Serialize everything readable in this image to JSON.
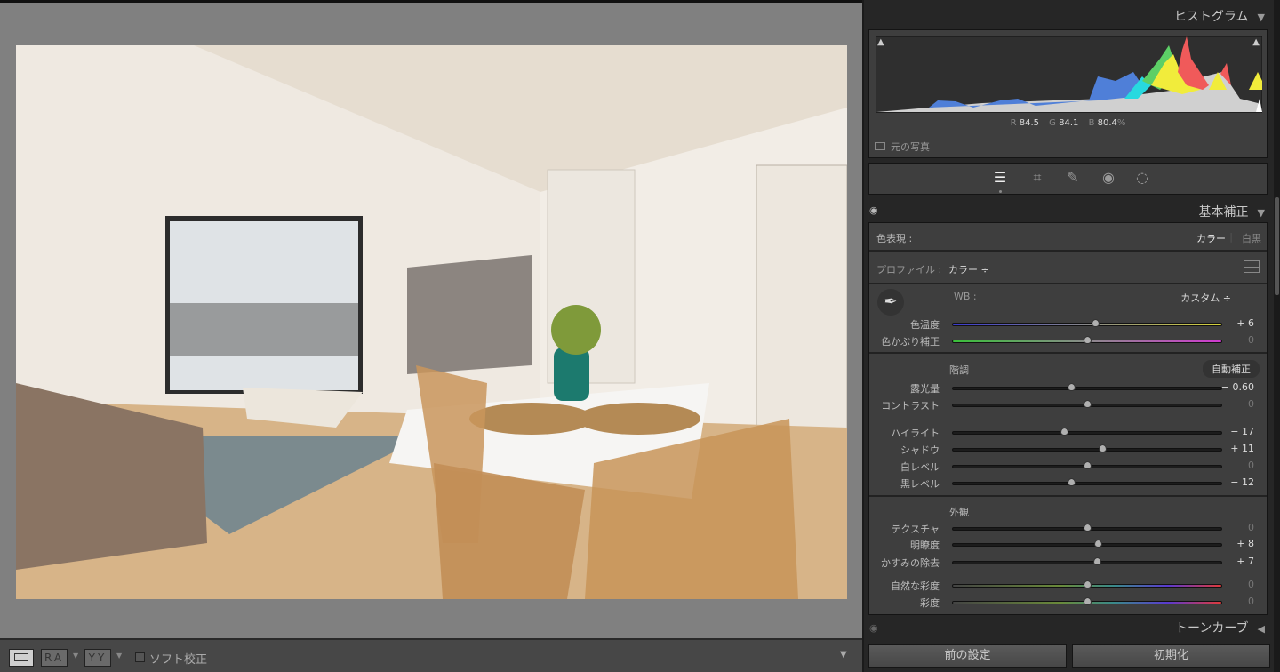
{
  "histogram": {
    "title": "ヒストグラム",
    "r_label": "R",
    "r": "84.5",
    "g_label": "G",
    "g": "84.1",
    "b_label": "B",
    "b": "80.4",
    "pct": "%",
    "original_photo": "元の写真"
  },
  "tools": [
    "edit-sliders",
    "crop",
    "healing",
    "red-eye",
    "masking"
  ],
  "basic": {
    "title": "基本補正",
    "treatment_label": "色表現 :",
    "treatment_color": "カラー",
    "treatment_bw": "白黒",
    "profile_label": "プロファイル :",
    "profile_value": "カラー ÷",
    "wb_label": "WB :",
    "wb_value": "カスタム ÷",
    "tone_label": "階調",
    "auto_label": "自動補正",
    "presence_label": "外観",
    "sliders": [
      {
        "label": "色温度",
        "value": "+ 6",
        "num": 6,
        "min": -100,
        "max": 100,
        "track": "temp"
      },
      {
        "label": "色かぶり補正",
        "value": "0",
        "num": 0,
        "min": -100,
        "max": 100,
        "track": "tint"
      },
      {
        "label": "露光量",
        "value": "− 0.60",
        "num": -0.6,
        "min": -5,
        "max": 5
      },
      {
        "label": "コントラスト",
        "value": "0",
        "num": 0,
        "min": -100,
        "max": 100
      },
      {
        "label": "ハイライト",
        "value": "− 17",
        "num": -17,
        "min": -100,
        "max": 100
      },
      {
        "label": "シャドウ",
        "value": "+ 11",
        "num": 11,
        "min": -100,
        "max": 100
      },
      {
        "label": "白レベル",
        "value": "0",
        "num": 0,
        "min": -100,
        "max": 100
      },
      {
        "label": "黒レベル",
        "value": "− 12",
        "num": -12,
        "min": -100,
        "max": 100
      },
      {
        "label": "テクスチャ",
        "value": "0",
        "num": 0,
        "min": -100,
        "max": 100
      },
      {
        "label": "明瞭度",
        "value": "+ 8",
        "num": 8,
        "min": -100,
        "max": 100
      },
      {
        "label": "かすみの除去",
        "value": "+ 7",
        "num": 7,
        "min": -100,
        "max": 100
      },
      {
        "label": "自然な彩度",
        "value": "0",
        "num": 0,
        "min": -100,
        "max": 100,
        "track": "sat"
      },
      {
        "label": "彩度",
        "value": "0",
        "num": 0,
        "min": -100,
        "max": 100,
        "track": "sat"
      }
    ]
  },
  "tone_curve": {
    "title": "トーンカーブ"
  },
  "buttons": {
    "previous": "前の設定",
    "reset": "初期化"
  },
  "toolbar": {
    "ra": "RA",
    "yy": "YY",
    "soft_proof": "ソフト校正"
  }
}
